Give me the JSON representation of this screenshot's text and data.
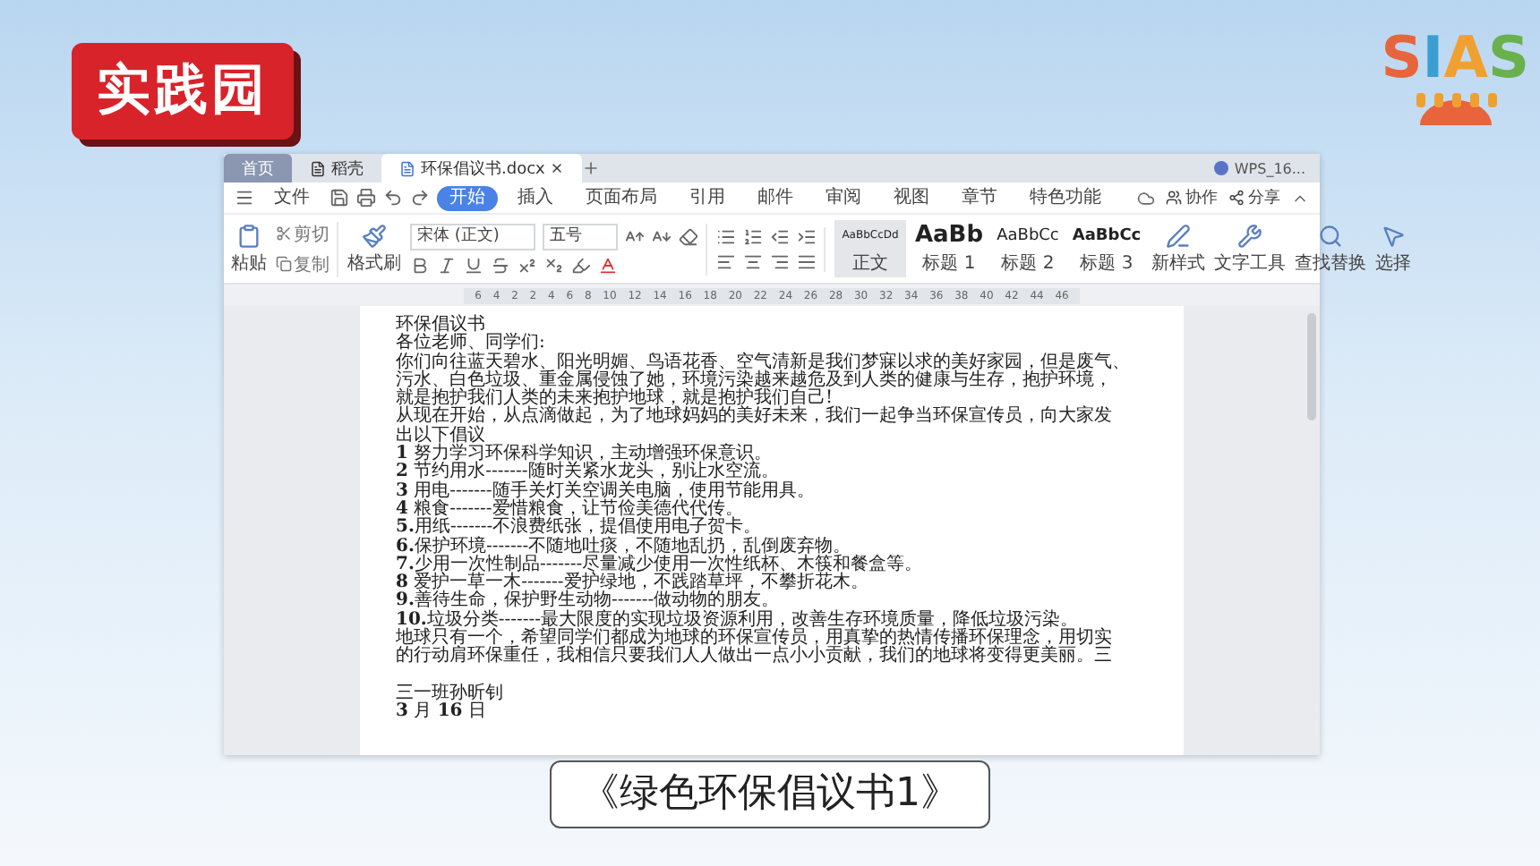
{
  "badge": {
    "text": "实践园"
  },
  "logo": {
    "letters": [
      {
        "char": "S",
        "color": "#e8643c"
      },
      {
        "char": "I",
        "color": "#3a9fd0"
      },
      {
        "char": "A",
        "color": "#f0a030"
      },
      {
        "char": "S",
        "color": "#6ab04c"
      }
    ]
  },
  "window": {
    "tabs": [
      {
        "label": "首页",
        "kind": "home",
        "selected": false
      },
      {
        "label": "稻壳",
        "kind": "docer",
        "selected": false
      },
      {
        "label": "环保倡议书.docx",
        "kind": "document",
        "selected": true
      }
    ],
    "account": "WPS_16...",
    "file_menu": "文件",
    "ribbon_tabs": [
      {
        "label": "开始",
        "selected": true
      },
      {
        "label": "插入",
        "selected": false
      },
      {
        "label": "页面布局",
        "selected": false
      },
      {
        "label": "引用",
        "selected": false
      },
      {
        "label": "邮件",
        "selected": false
      },
      {
        "label": "审阅",
        "selected": false
      },
      {
        "label": "视图",
        "selected": false
      },
      {
        "label": "章节",
        "selected": false
      },
      {
        "label": "特色功能",
        "selected": false
      }
    ],
    "actions": [
      {
        "label": "协作",
        "kind": "collab"
      },
      {
        "label": "分享",
        "kind": "share"
      }
    ],
    "clipboard": {
      "paste": "粘贴",
      "cut": "剪切",
      "copy": "复制",
      "format_painter": "格式刷"
    },
    "font": {
      "family": "宋体 (正文)",
      "size": "五号"
    },
    "styles": [
      {
        "preview": "AaBbCcDd",
        "label": "正文",
        "kind": "body",
        "selected": true
      },
      {
        "preview": "AaBb",
        "label": "标题 1",
        "kind": "h1",
        "selected": false
      },
      {
        "preview": "AaBbCc",
        "label": "标题 2",
        "kind": "h2",
        "selected": false
      },
      {
        "preview": "AaBbCc",
        "label": "标题 3",
        "kind": "h3",
        "selected": false
      }
    ],
    "tools": [
      {
        "label": "新样式",
        "kind": "style"
      },
      {
        "label": "文字工具",
        "kind": "text"
      },
      {
        "label": "查找替换",
        "kind": "find"
      },
      {
        "label": "选择",
        "kind": "select"
      }
    ],
    "ruler": [
      "6",
      "4",
      "2",
      "2",
      "4",
      "6",
      "8",
      "10",
      "12",
      "14",
      "16",
      "18",
      "20",
      "22",
      "24",
      "26",
      "28",
      "30",
      "32",
      "34",
      "36",
      "38",
      "40",
      "42",
      "44",
      "46"
    ],
    "document": {
      "lines": [
        "环保倡议书",
        "各位老师、同学们:",
        "你们向往蓝天碧水、阳光明媚、鸟语花香、空气清新是我们梦寐以求的美好家园，但是废气、",
        "污水、白色垃圾、重金属侵蚀了她，环境污染越来越危及到人类的健康与生存，抱护环境，",
        "就是抱护我们人类的未来抱护地球，就是抱护我们自己!",
        "从现在开始，从点滴做起，为了地球妈妈的美好未来，我们一起争当环保宣传员，向大家发",
        "出以下倡议",
        "**1** 努力学习环保科学知识，主动增强环保意识。",
        "**2** 节约用水-------随时关紧水龙头，别让水空流。",
        "**3** 用电-------随手关灯关空调关电脑，使用节能用具。",
        "**4** 粮食-------爱惜粮食，让节俭美德代代传。",
        "**5.**用纸-------不浪费纸张，提倡使用电子贺卡。",
        "**6.**保护环境-------不随地吐痰，不随地乱扔，乱倒废弃物。",
        "**7.**少用一次性制品-------尽量减少使用一次性纸杯、木筷和餐盒等。",
        "**8** 爱护一草一木-------爱护绿地，不践踏草坪，不攀折花木。",
        "**9.**善待生命，保护野生动物-------做动物的朋友。",
        "**10.**垃圾分类-------最大限度的实现垃圾资源利用，改善生存环境质量，降低垃圾污染。",
        "地球只有一个，希望同学们都成为地球的环保宣传员，用真挚的热情传播环保理念，用切实",
        "的行动肩环保重任，我相信只要我们人人做出一点小小贡献，我们的地球将变得更美丽。三"
      ],
      "signature": "三一班孙昕钊",
      "date": "**3** 月 **16** 日"
    }
  },
  "caption": "《绿色环保倡议书1》"
}
